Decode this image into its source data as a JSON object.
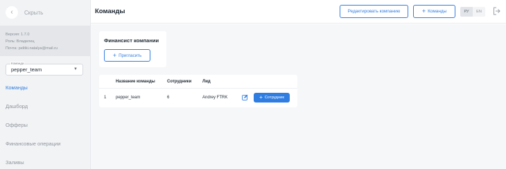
{
  "sidebar": {
    "hide_label": "Скрыть",
    "version": "Версия: 1.7.0",
    "role": "Роль: Владелец",
    "email": "Почта: pelitki.natalya@mail.ru",
    "team_select": {
      "label": "Команда",
      "value": "pepper_team"
    },
    "nav": [
      {
        "label": "Команды",
        "active": true
      },
      {
        "label": "Дашборд",
        "active": false
      },
      {
        "label": "Офферы",
        "active": false
      },
      {
        "label": "Финансовые операции",
        "active": false
      },
      {
        "label": "Заливы",
        "active": false
      }
    ]
  },
  "header": {
    "title": "Команды",
    "edit_company_label": "Редактировать компанию",
    "teams_button_label": "Команды",
    "languages": [
      {
        "code": "РУ",
        "active": true
      },
      {
        "code": "EN",
        "active": false
      }
    ]
  },
  "finance_card": {
    "title": "Финансист компании",
    "invite_label": "Пригласить"
  },
  "teams_table": {
    "columns": [
      "Название команды",
      "Сотрудники",
      "Лид"
    ],
    "rows": [
      {
        "index": "1",
        "name": "pepper_team",
        "employees": "6",
        "lead": "Andrey FTRK",
        "add_employee_label": "Сотрудник"
      }
    ]
  },
  "colors": {
    "accent": "#2f7de1",
    "sidebar_bg": "#f2f3f5",
    "main_bg": "#f6f7f9"
  }
}
